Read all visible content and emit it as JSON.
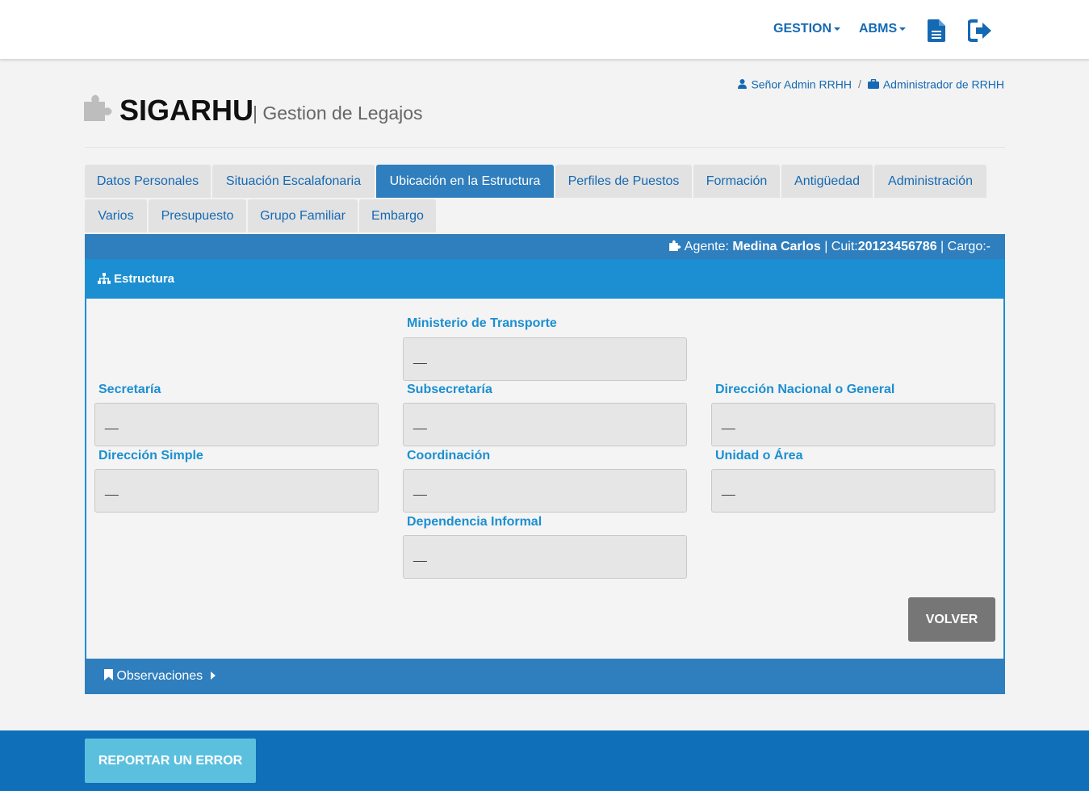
{
  "nav": {
    "gestion": "GESTION",
    "abms": "ABMS",
    "doc_icon": "file-text-icon",
    "logout_icon": "sign-out-icon"
  },
  "user": {
    "name": "Señor Admin RRHH",
    "separator": "/",
    "role": "Administrador de RRHH"
  },
  "header": {
    "brand": "SIGARHU",
    "subtitle": "| Gestion de Legajos"
  },
  "tabs": [
    {
      "label": "Datos Personales",
      "active": false
    },
    {
      "label": "Situación Escalafonaria",
      "active": false
    },
    {
      "label": "Ubicación en la Estructura",
      "active": true
    },
    {
      "label": "Perfiles de Puestos",
      "active": false
    },
    {
      "label": "Formación",
      "active": false
    },
    {
      "label": "Antigüedad",
      "active": false
    },
    {
      "label": "Administración",
      "active": false
    },
    {
      "label": "Varios",
      "active": false
    },
    {
      "label": "Presupuesto",
      "active": false
    },
    {
      "label": "Grupo Familiar",
      "active": false
    },
    {
      "label": "Embargo",
      "active": false
    }
  ],
  "agent": {
    "agente_label": "Agente:",
    "agente_value": "Medina Carlos",
    "cuit_label": "| Cuit:",
    "cuit_value": "20123456786",
    "cargo_label": "| Cargo:-"
  },
  "panel": {
    "title": "Estructura"
  },
  "fields": {
    "ministerio": {
      "label": "Ministerio de Transporte",
      "value": "__"
    },
    "secretaria": {
      "label": "Secretaría",
      "value": "__"
    },
    "subsecretaria": {
      "label": "Subsecretaría",
      "value": "__"
    },
    "direccion_nacional": {
      "label": "Dirección Nacional o General",
      "value": "__"
    },
    "direccion_simple": {
      "label": "Dirección Simple",
      "value": "__"
    },
    "coordinacion": {
      "label": "Coordinación",
      "value": "__"
    },
    "unidad_area": {
      "label": "Unidad o Área",
      "value": "__"
    },
    "dependencia_informal": {
      "label": "Dependencia Informal",
      "value": "__"
    }
  },
  "buttons": {
    "volver": "VOLVER",
    "report": "REPORTAR UN ERROR"
  },
  "observaciones": {
    "label": "Observaciones"
  },
  "colors": {
    "primary": "#2f7ebd",
    "panel_head": "#1b8fd1",
    "footer": "#0f6fb9",
    "report_button": "#5bc0de",
    "volver_button": "#767676"
  }
}
